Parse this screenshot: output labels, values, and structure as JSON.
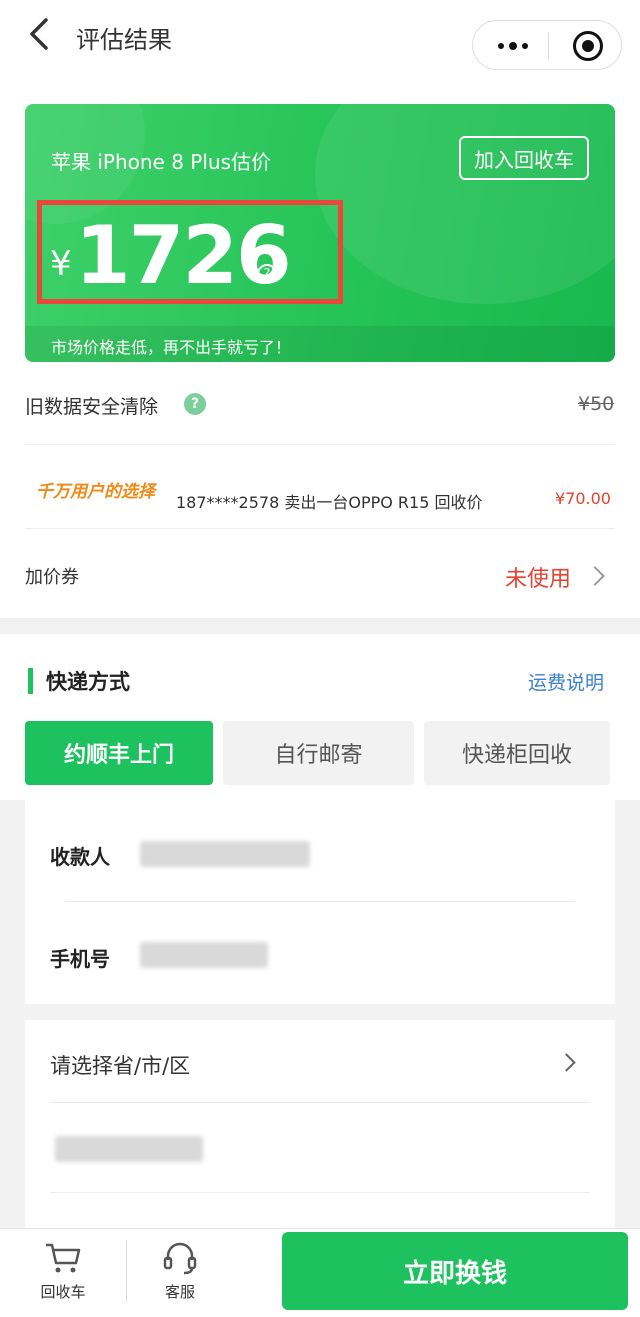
{
  "nav": {
    "title": "评估结果"
  },
  "card": {
    "title": "苹果 iPhone 8 Plus估价",
    "cart_button": "加入回收车",
    "currency": "¥",
    "price": "1726",
    "hint": "?",
    "footer_text": "市场价格走低，再不出手就亏了！"
  },
  "data_clear": {
    "label": "旧数据安全清除",
    "help": "?",
    "price": "¥50"
  },
  "ticker": {
    "slogan": "千万用户的选择",
    "message": "187****2578 卖出一台OPPO R15 回收价",
    "amount": "¥70.00"
  },
  "coupon": {
    "label": "加价券",
    "status": "未使用"
  },
  "shipping": {
    "title": "快递方式",
    "fee_link": "运费说明",
    "tabs": [
      {
        "label": "约顺丰上门"
      },
      {
        "label": "自行邮寄"
      },
      {
        "label": "快递柜回收"
      }
    ]
  },
  "form": {
    "payee_label": "收款人",
    "phone_label": "手机号",
    "region_placeholder": "请选择省/市/区"
  },
  "bottom": {
    "cart_label": "回收车",
    "service_label": "客服",
    "submit_label": "立即换钱"
  },
  "colors": {
    "brand_green": "#1dc15e",
    "alert_red": "#e5432e",
    "link_blue": "#3a7fd4"
  },
  "icons": [
    "back-arrow-icon",
    "more-dots-icon",
    "target-icon",
    "question-icon",
    "chevron-right-icon",
    "cart-icon",
    "headset-icon"
  ]
}
